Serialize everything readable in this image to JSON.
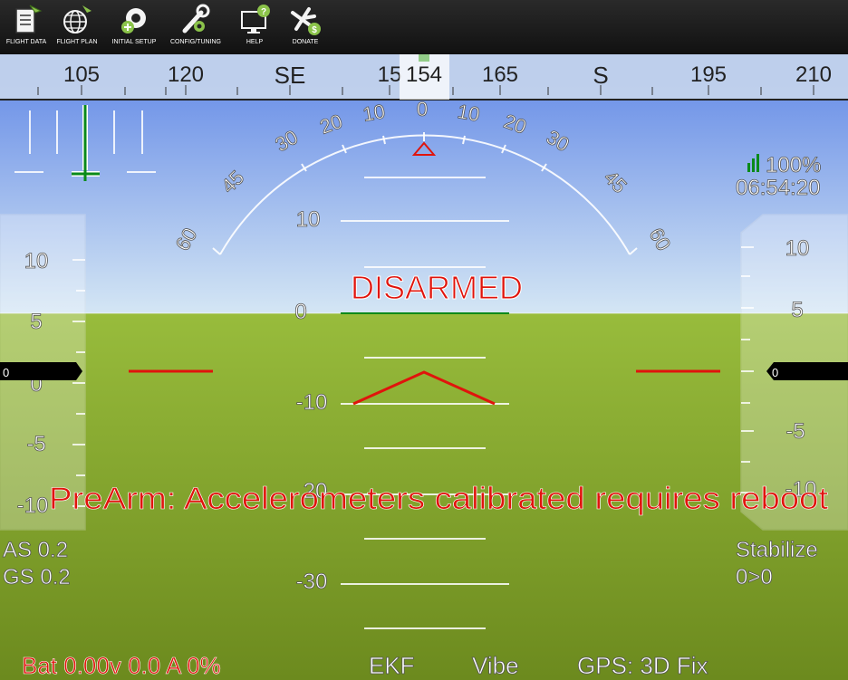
{
  "toolbar": {
    "items": [
      {
        "label": "FLIGHT DATA",
        "icon": "flight-data-icon"
      },
      {
        "label": "FLIGHT PLAN",
        "icon": "flight-plan-icon"
      },
      {
        "label": "INITIAL SETUP",
        "icon": "initial-setup-icon"
      },
      {
        "label": "CONFIG/TUNING",
        "icon": "config-tuning-icon"
      },
      {
        "label": "HELP",
        "icon": "help-icon"
      },
      {
        "label": "DONATE",
        "icon": "donate-icon"
      }
    ]
  },
  "heading_tape": {
    "ticks": [
      "105",
      "120",
      "SE",
      "15",
      "165",
      "S",
      "195",
      "210"
    ],
    "current": "154"
  },
  "roll_scale": {
    "labels_left": [
      "10",
      "20",
      "30",
      "45",
      "60"
    ],
    "center": "0",
    "labels_right": [
      "10",
      "20",
      "30",
      "45",
      "60"
    ]
  },
  "pitch_ladder": {
    "labels": [
      "10",
      "0",
      "-10",
      "20",
      "-30"
    ]
  },
  "speed_tape": {
    "labels": [
      "10",
      "5",
      "0",
      "-5",
      "-10"
    ],
    "current": "0"
  },
  "alt_tape": {
    "labels": [
      "10",
      "5",
      "0",
      "-5",
      "-10"
    ],
    "current": "0"
  },
  "status": {
    "link_quality": "100%",
    "time": "06:54:20",
    "armed_state": "DISARMED",
    "message": "PreArm: Accelerometers calibrated requires reboot",
    "airspeed": "AS 0.2",
    "groundspeed": "GS 0.2",
    "mode": "Stabilize",
    "waypoint": "0>0",
    "battery": "Bat 0.00v 0.0 A 0%",
    "ekf": "EKF",
    "vibe": "Vibe",
    "gps": "GPS: 3D Fix"
  },
  "colors": {
    "sky_top": "#5f86e6",
    "sky_bottom": "#cfe3f3",
    "ground_top": "#8fb53a",
    "ground_bottom": "#6e8c1f",
    "alert_red": "#e0140c",
    "ladder_white": "#ffffff",
    "good_green": "#0a8a1a"
  }
}
